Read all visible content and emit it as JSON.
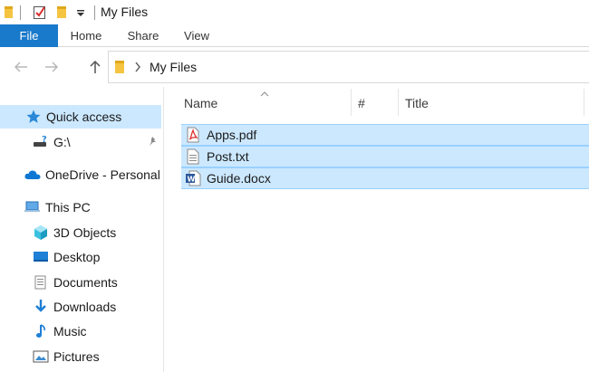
{
  "window": {
    "title": "My Files"
  },
  "ribbon": {
    "tabs": [
      "File",
      "Home",
      "Share",
      "View"
    ]
  },
  "address": {
    "crumbs": [
      "My Files"
    ]
  },
  "nav": {
    "items": [
      {
        "label": "Quick access",
        "icon": "star-icon",
        "selected": true
      },
      {
        "label": "G:\\",
        "icon": "drive-icon",
        "pinned": true
      },
      {
        "label": "OneDrive - Personal",
        "icon": "cloud-icon"
      },
      {
        "label": "This PC",
        "icon": "computer-icon"
      },
      {
        "label": "3D Objects",
        "icon": "cube-icon"
      },
      {
        "label": "Desktop",
        "icon": "desktop-icon"
      },
      {
        "label": "Documents",
        "icon": "documents-icon"
      },
      {
        "label": "Downloads",
        "icon": "download-icon"
      },
      {
        "label": "Music",
        "icon": "music-icon"
      },
      {
        "label": "Pictures",
        "icon": "pictures-icon"
      }
    ]
  },
  "columns": {
    "name": "Name",
    "number": "#",
    "title": "Title"
  },
  "files": [
    {
      "name": "Apps.pdf",
      "icon": "pdf-icon"
    },
    {
      "name": "Post.txt",
      "icon": "text-file-icon"
    },
    {
      "name": "Guide.docx",
      "icon": "word-doc-icon"
    }
  ],
  "colors": {
    "accent": "#1979ca",
    "selection": "#cce8ff",
    "selection_border": "#99d1ff"
  }
}
